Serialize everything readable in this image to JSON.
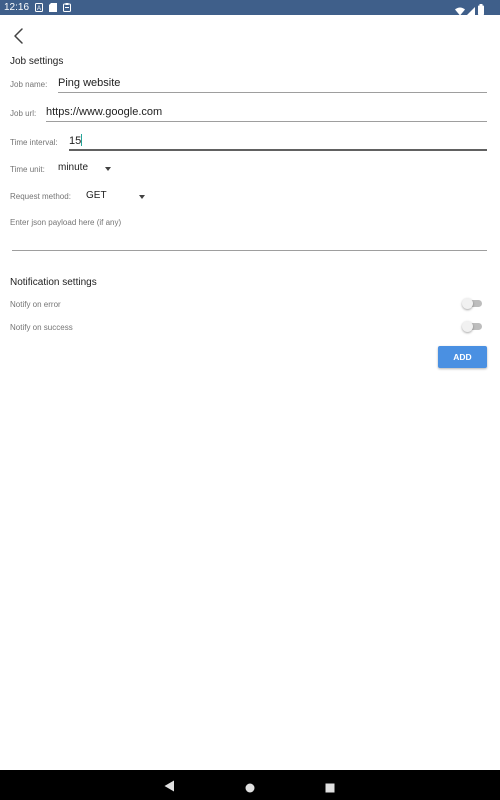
{
  "status_bar": {
    "time": "12:16",
    "icons": [
      "notification-a-icon",
      "sd-card-icon",
      "clipboard-icon",
      "wifi-icon",
      "signal-icon",
      "battery-icon"
    ]
  },
  "header": {
    "back_icon": "chevron-left-icon"
  },
  "job_settings": {
    "title": "Job settings",
    "job_name": {
      "label": "Job name:",
      "value": "Ping website"
    },
    "job_url": {
      "label": "Job url:",
      "value": "https://www.google.com"
    },
    "time_interval": {
      "label": "Time interval:",
      "value": "15"
    },
    "time_unit": {
      "label": "Time unit:",
      "selected": "minute"
    },
    "request_method": {
      "label": "Request method:",
      "selected": "GET"
    },
    "json_payload": {
      "placeholder": "Enter json payload here (if any)",
      "value": ""
    }
  },
  "notification_settings": {
    "title": "Notification settings",
    "notify_on_error": {
      "label": "Notify on error",
      "enabled": false
    },
    "notify_on_success": {
      "label": "Notify on success",
      "enabled": false
    }
  },
  "actions": {
    "add_label": "ADD"
  },
  "colors": {
    "status_bar": "#3f5f8a",
    "accent": "#4a90e2",
    "cursor": "#26a69a",
    "nav_bar": "#000000"
  }
}
